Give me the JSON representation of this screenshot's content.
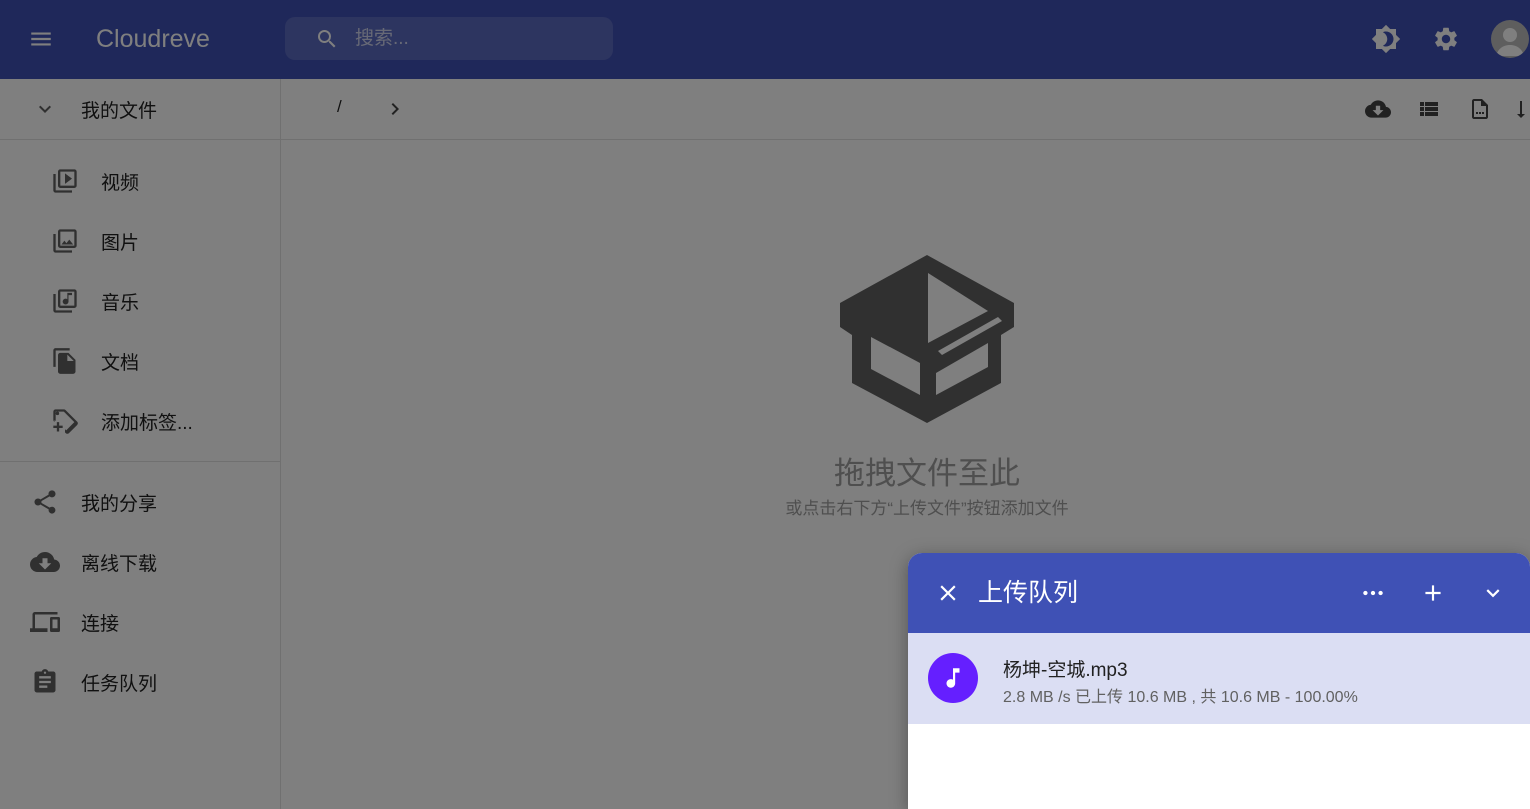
{
  "app": {
    "title": "Cloudreve"
  },
  "search": {
    "placeholder": "搜索..."
  },
  "header": {
    "icons": [
      "menu-icon",
      "search-icon",
      "theme-toggle-icon",
      "gear-icon",
      "account-icon"
    ]
  },
  "sidebar": {
    "my_files": "我的文件",
    "categories": [
      {
        "label": "视频",
        "icon": "video-library-icon"
      },
      {
        "label": "图片",
        "icon": "photo-library-icon"
      },
      {
        "label": "音乐",
        "icon": "music-library-icon"
      },
      {
        "label": "文档",
        "icon": "file-copy-icon"
      },
      {
        "label": "添加标签...",
        "icon": "tag-plus-icon"
      }
    ],
    "nav": [
      {
        "label": "我的分享",
        "icon": "share-icon"
      },
      {
        "label": "离线下载",
        "icon": "cloud-download-icon"
      },
      {
        "label": "连接",
        "icon": "devices-icon"
      },
      {
        "label": "任务队列",
        "icon": "clipboard-icon"
      }
    ]
  },
  "breadcrumb": {
    "root": "/"
  },
  "toolbar": {
    "icons": [
      "cloud-download-icon",
      "list-view-icon",
      "page-settings-icon",
      "sort-icon"
    ]
  },
  "empty_state": {
    "title": "拖拽文件至此",
    "subtitle": "或点击右下方“上传文件”按钮添加文件"
  },
  "upload_queue": {
    "title": "上传队列",
    "items": [
      {
        "filename": "杨坤-空城.mp3",
        "status": "2.8 MB /s 已上传 10.6 MB , 共 10.6 MB - 100.00%",
        "progress": 1.0,
        "icon": "music-note-icon"
      }
    ]
  },
  "colors": {
    "primary": "#3f51b5",
    "file_icon_bg": "#651fff",
    "item_bg": "#dbdef3"
  }
}
